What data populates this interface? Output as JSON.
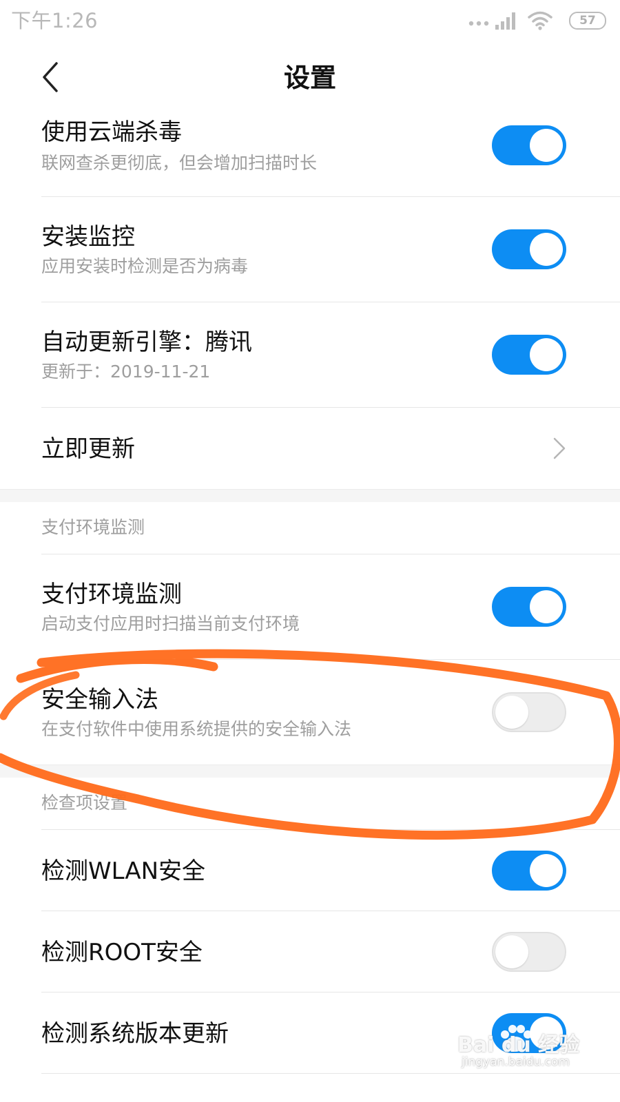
{
  "status_bar": {
    "time": "下午1:26",
    "battery_level": "57",
    "icons": [
      "dots-icon",
      "signal-icon",
      "wifi-icon",
      "battery-icon"
    ]
  },
  "header": {
    "title": "设置",
    "back_icon": "back-arrow-icon"
  },
  "colors": {
    "toggle_on": "#0d8df3",
    "toggle_off": "#ededed",
    "annotation": "#ff6a1a"
  },
  "rows": [
    {
      "title": "使用云端杀毒",
      "subtitle": "联网查杀更彻底，但会增加扫描时长",
      "toggle": "on"
    },
    {
      "title": "安装监控",
      "subtitle": "应用安装时检测是否为病毒",
      "toggle": "on"
    },
    {
      "title": "自动更新引擎：腾讯",
      "subtitle": "更新于：2019-11-21",
      "toggle": "on"
    },
    {
      "title": "立即更新",
      "accessory": "chevron-right-icon"
    }
  ],
  "payment_section": {
    "header": "支付环境监测",
    "rows": [
      {
        "title": "支付环境监测",
        "subtitle": "启动支付应用时扫描当前支付环境",
        "toggle": "on"
      },
      {
        "title": "安全输入法",
        "subtitle": "在支付软件中使用系统提供的安全输入法",
        "toggle": "off"
      }
    ]
  },
  "check_section": {
    "header": "检查项设置",
    "rows": [
      {
        "title": "检测WLAN安全",
        "toggle": "on"
      },
      {
        "title": "检测ROOT安全",
        "toggle": "off"
      },
      {
        "title": "检测系统版本更新",
        "toggle": "on"
      }
    ]
  },
  "watermark": {
    "brand": "Bai du 经验",
    "url": "jingyan.baidu.com"
  }
}
